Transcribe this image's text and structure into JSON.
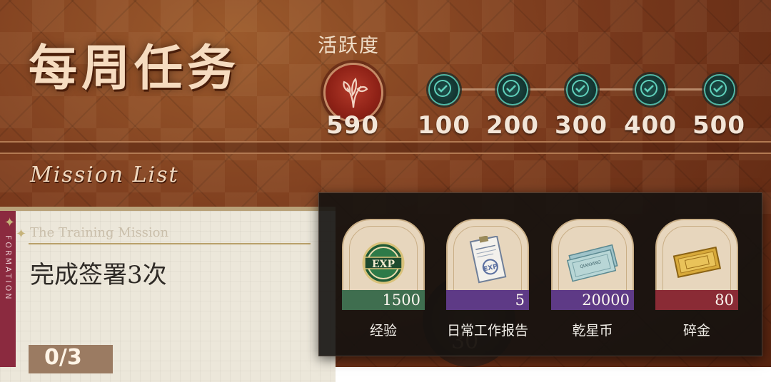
{
  "header": {
    "title": "每周任务",
    "subtitle": "Mission List"
  },
  "activity": {
    "label": "活跃度",
    "current": "590",
    "milestones": [
      "100",
      "200",
      "300",
      "400",
      "500"
    ]
  },
  "mission": {
    "category": "The Training Mission",
    "name": "完成签署3次",
    "progress": "0/3",
    "side_label": "FORMATION",
    "medal_number": "30"
  },
  "rewards": [
    {
      "name": "经验",
      "quantity": "1500",
      "band_color": "#3f6e4f",
      "icon": "exp-icon"
    },
    {
      "name": "日常工作报告",
      "quantity": "5",
      "band_color": "#5e3a86",
      "icon": "report-icon"
    },
    {
      "name": "乾星币",
      "quantity": "20000",
      "band_color": "#5e3a86",
      "icon": "banknote-icon"
    },
    {
      "name": "碎金",
      "quantity": "80",
      "band_color": "#8a2b35",
      "icon": "gold-bar-icon"
    }
  ],
  "colors": {
    "check": "#4fb7a5",
    "panel": "#141210"
  }
}
